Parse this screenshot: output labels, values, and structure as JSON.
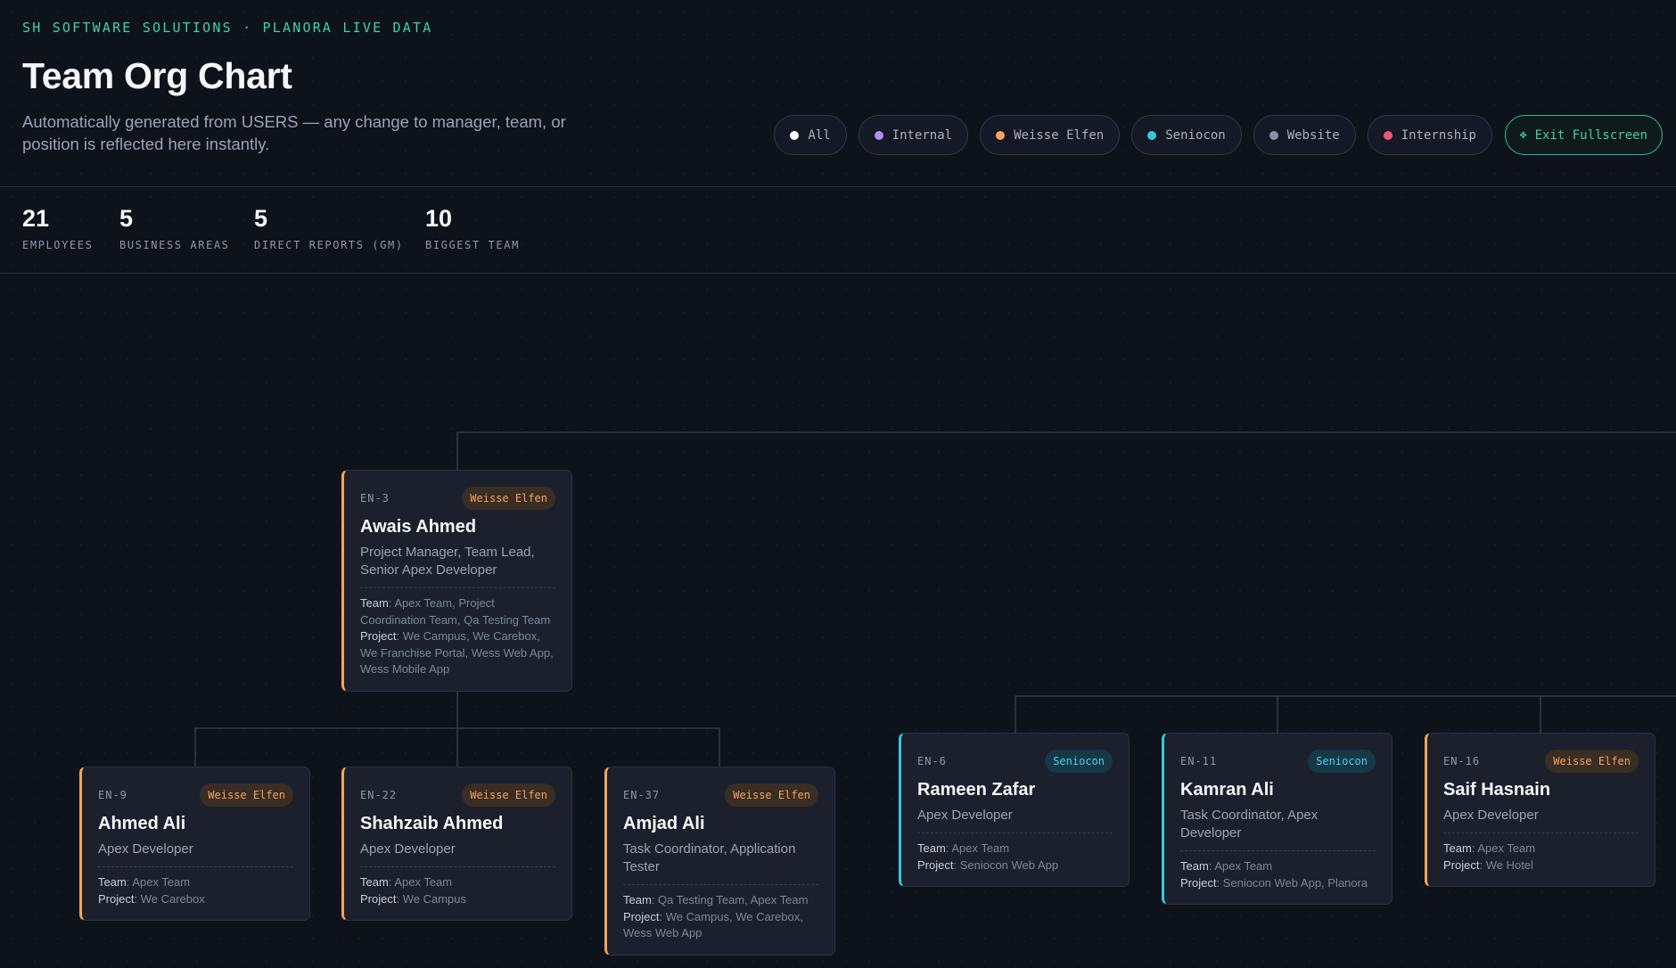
{
  "header": {
    "kicker": "SH SOFTWARE SOLUTIONS · PLANORA LIVE DATA",
    "title": "Team Org Chart",
    "subtitle": "Automatically generated from USERS — any change to manager, team, or position is reflected here instantly.",
    "filters": [
      {
        "label": "All",
        "color": "#ffffff"
      },
      {
        "label": "Internal",
        "color": "#b58cf0"
      },
      {
        "label": "Weisse Elfen",
        "color": "#f5a35a"
      },
      {
        "label": "Seniocon",
        "color": "#38c6dc"
      },
      {
        "label": "Website",
        "color": "#8a93a6"
      },
      {
        "label": "Internship",
        "color": "#f0567a"
      }
    ],
    "exit_label": "Exit Fullscreen",
    "exit_icon": "move-arrows-icon"
  },
  "stats": [
    {
      "value": "21",
      "label": "EMPLOYEES"
    },
    {
      "value": "5",
      "label": "BUSINESS AREAS"
    },
    {
      "value": "5",
      "label": "DIRECT REPORTS (GM)"
    },
    {
      "value": "10",
      "label": "BIGGEST TEAM"
    }
  ],
  "labels": {
    "team": "Team",
    "project": "Project"
  },
  "colors": {
    "accent": "#3fd2a6",
    "weisse_elfen": "#f5a35a",
    "seniocon": "#38c6dc"
  },
  "employees": [
    {
      "id": "EN-3",
      "area": "Weisse Elfen",
      "name": "Awais Ahmed",
      "position": "Project Manager, Team Lead, Senior Apex Developer",
      "team": "Apex Team, Project Coordination Team, Qa Testing Team",
      "project": "We Campus, We Carebox, We Franchise Portal, Wess Web App, Wess Mobile App"
    },
    {
      "id": "EN-9",
      "area": "Weisse Elfen",
      "name": "Ahmed Ali",
      "position": "Apex Developer",
      "team": "Apex Team",
      "project": "We Carebox"
    },
    {
      "id": "EN-22",
      "area": "Weisse Elfen",
      "name": "Shahzaib Ahmed",
      "position": "Apex Developer",
      "team": "Apex Team",
      "project": "We Campus"
    },
    {
      "id": "EN-37",
      "area": "Weisse Elfen",
      "name": "Amjad Ali",
      "position": "Task Coordinator, Application Tester",
      "team": "Qa Testing Team, Apex Team",
      "project": "We Campus, We Carebox, Wess Web App"
    },
    {
      "id": "EN-6",
      "area": "Seniocon",
      "name": "Rameen Zafar",
      "position": "Apex Developer",
      "team": "Apex Team",
      "project": "Seniocon Web App"
    },
    {
      "id": "EN-11",
      "area": "Seniocon",
      "name": "Kamran Ali",
      "position": "Task Coordinator, Apex Developer",
      "team": "Apex Team",
      "project": "Seniocon Web App, Planora"
    },
    {
      "id": "EN-16",
      "area": "Weisse Elfen",
      "name": "Saif Hasnain",
      "position": "Apex Developer",
      "team": "Apex Team",
      "project": "We Hotel"
    }
  ]
}
